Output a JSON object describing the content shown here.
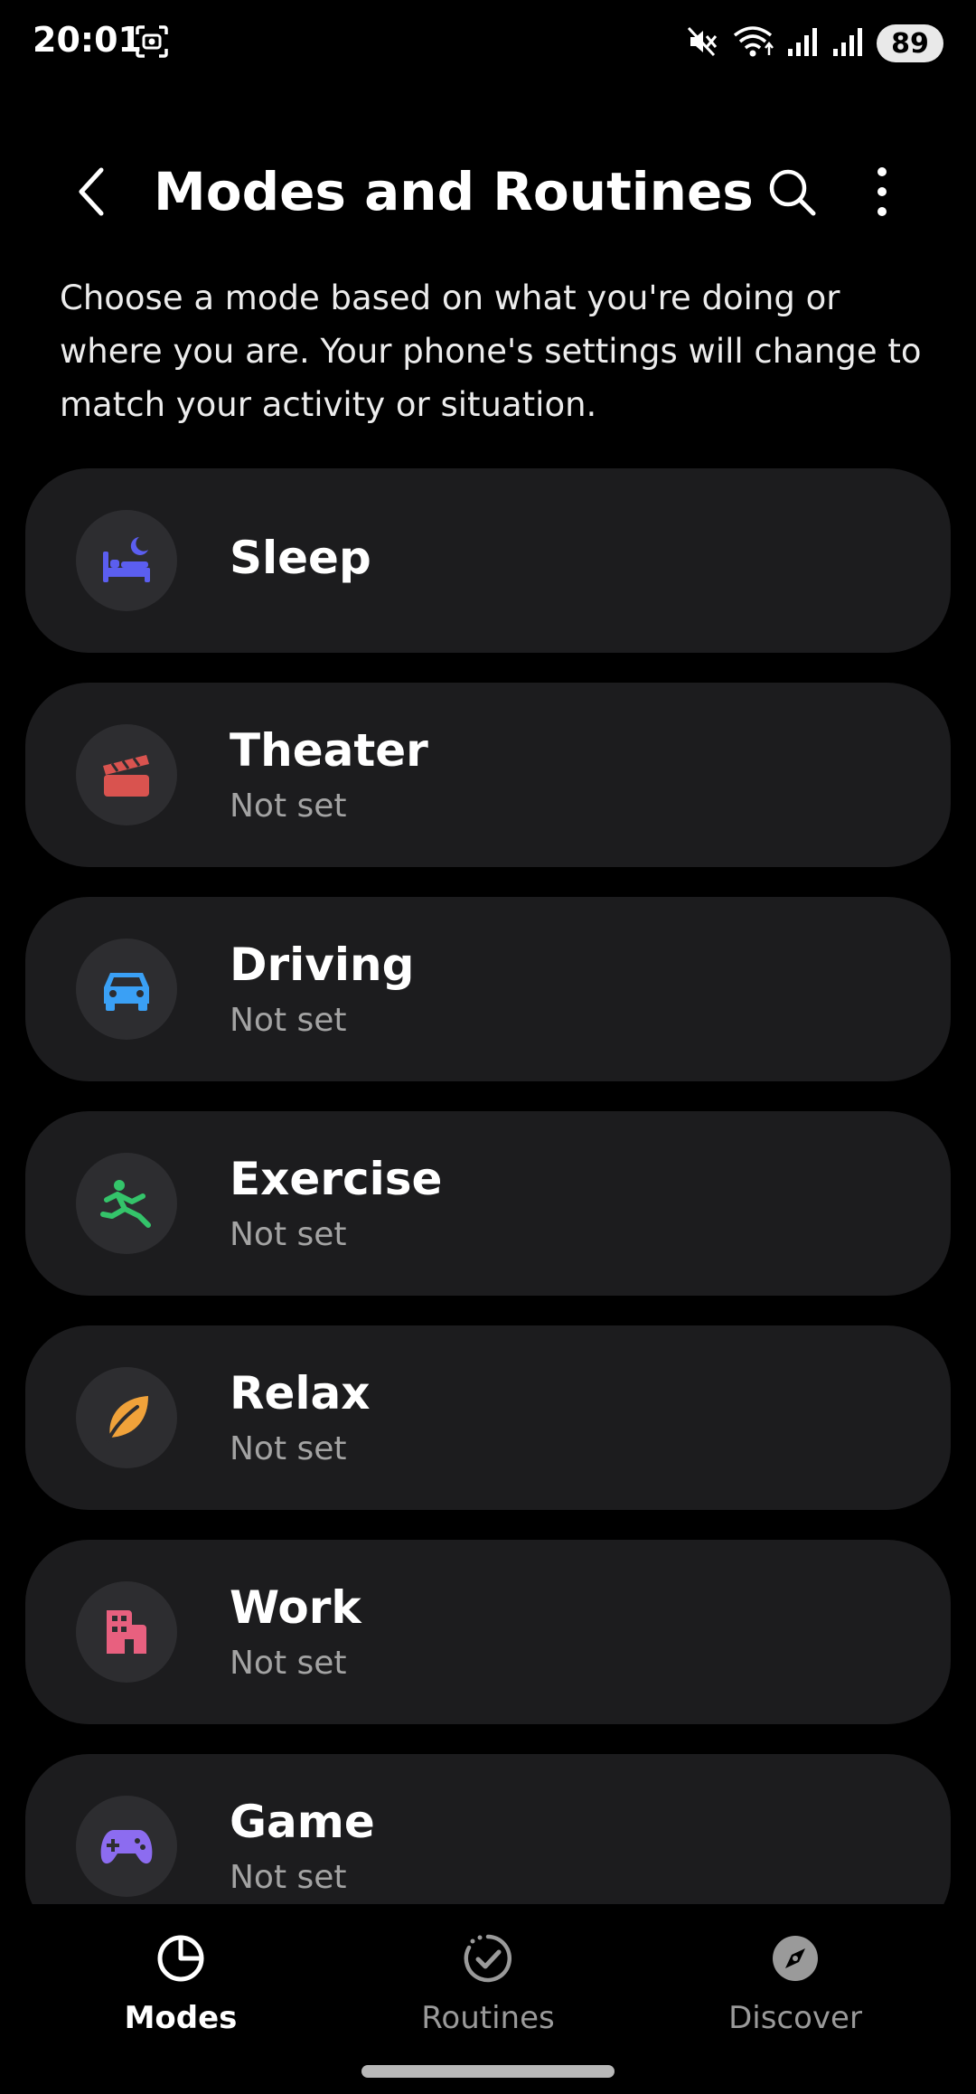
{
  "status_bar": {
    "time": "20:01",
    "battery": "89",
    "icons": [
      "screenshot-icon",
      "mute-icon",
      "wifi-icon",
      "signal-icon",
      "signal-icon",
      "battery-icon"
    ]
  },
  "header": {
    "title": "Modes and Routines",
    "icons": [
      "back-arrow-icon",
      "search-icon",
      "more-vertical-icon"
    ]
  },
  "description": "Choose a mode based on what you're doing or where you are. Your phone's settings will change to match your activity or situation.",
  "modes": [
    {
      "name": "Sleep",
      "status": "",
      "icon": "bed-moon-icon",
      "color": "#5b5ef0"
    },
    {
      "name": "Theater",
      "status": "Not set",
      "icon": "clapperboard-icon",
      "color": "#d9534f"
    },
    {
      "name": "Driving",
      "status": "Not set",
      "icon": "car-icon",
      "color": "#3aa0f5"
    },
    {
      "name": "Exercise",
      "status": "Not set",
      "icon": "runner-icon",
      "color": "#34c46a"
    },
    {
      "name": "Relax",
      "status": "Not set",
      "icon": "leaf-icon",
      "color": "#f0a23a"
    },
    {
      "name": "Work",
      "status": "Not set",
      "icon": "building-icon",
      "color": "#e8607f"
    },
    {
      "name": "Game",
      "status": "Not set",
      "icon": "gamepad-icon",
      "color": "#8c6cf0"
    }
  ],
  "bottom_nav": [
    {
      "label": "Modes",
      "icon": "modes-pie-icon",
      "active": true
    },
    {
      "label": "Routines",
      "icon": "routines-check-icon",
      "active": false
    },
    {
      "label": "Discover",
      "icon": "compass-icon",
      "active": false
    }
  ]
}
